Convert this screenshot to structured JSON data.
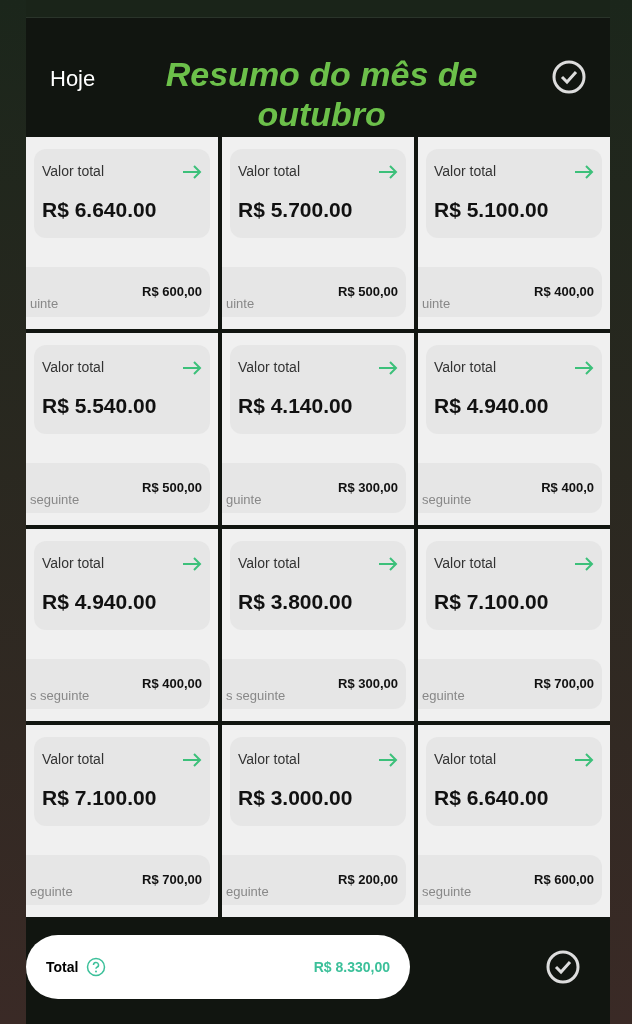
{
  "header": {
    "label": "Hoje",
    "title": "Resumo do mês de outubro"
  },
  "tiles": [
    {
      "label": "Valor total",
      "amount": "R$ 6.640.00",
      "note": "uinte",
      "value": "R$ 600,00"
    },
    {
      "label": "Valor total",
      "amount": "R$ 5.700.00",
      "note": "uinte",
      "value": "R$ 500,00"
    },
    {
      "label": "Valor total",
      "amount": "R$ 5.100.00",
      "note": "uinte",
      "value": "R$ 400,00"
    },
    {
      "label": "Valor total",
      "amount": "R$ 5.540.00",
      "note": "seguinte",
      "value": "R$ 500,00"
    },
    {
      "label": "Valor total",
      "amount": "R$ 4.140.00",
      "note": "guinte",
      "value": "R$ 300,00"
    },
    {
      "label": "Valor total",
      "amount": "R$ 4.940.00",
      "note": "seguinte",
      "value": "R$ 400,0"
    },
    {
      "label": "Valor total",
      "amount": "R$ 4.940.00",
      "note": "s seguinte",
      "value": "R$ 400,00"
    },
    {
      "label": "Valor total",
      "amount": "R$ 3.800.00",
      "note": "s seguinte",
      "value": "R$ 300,00"
    },
    {
      "label": "Valor total",
      "amount": "R$ 7.100.00",
      "note": "eguinte",
      "value": "R$ 700,00"
    },
    {
      "label": "Valor total",
      "amount": "R$ 7.100.00",
      "note": "eguinte",
      "value": "R$ 700,00"
    },
    {
      "label": "Valor total",
      "amount": "R$ 3.000.00",
      "note": "eguinte",
      "value": "R$ 200,00"
    },
    {
      "label": "Valor total",
      "amount": "R$ 6.640.00",
      "note": "seguinte",
      "value": "R$ 600,00"
    }
  ],
  "footer": {
    "label": "Total",
    "amount": "R$ 8.330,00"
  }
}
